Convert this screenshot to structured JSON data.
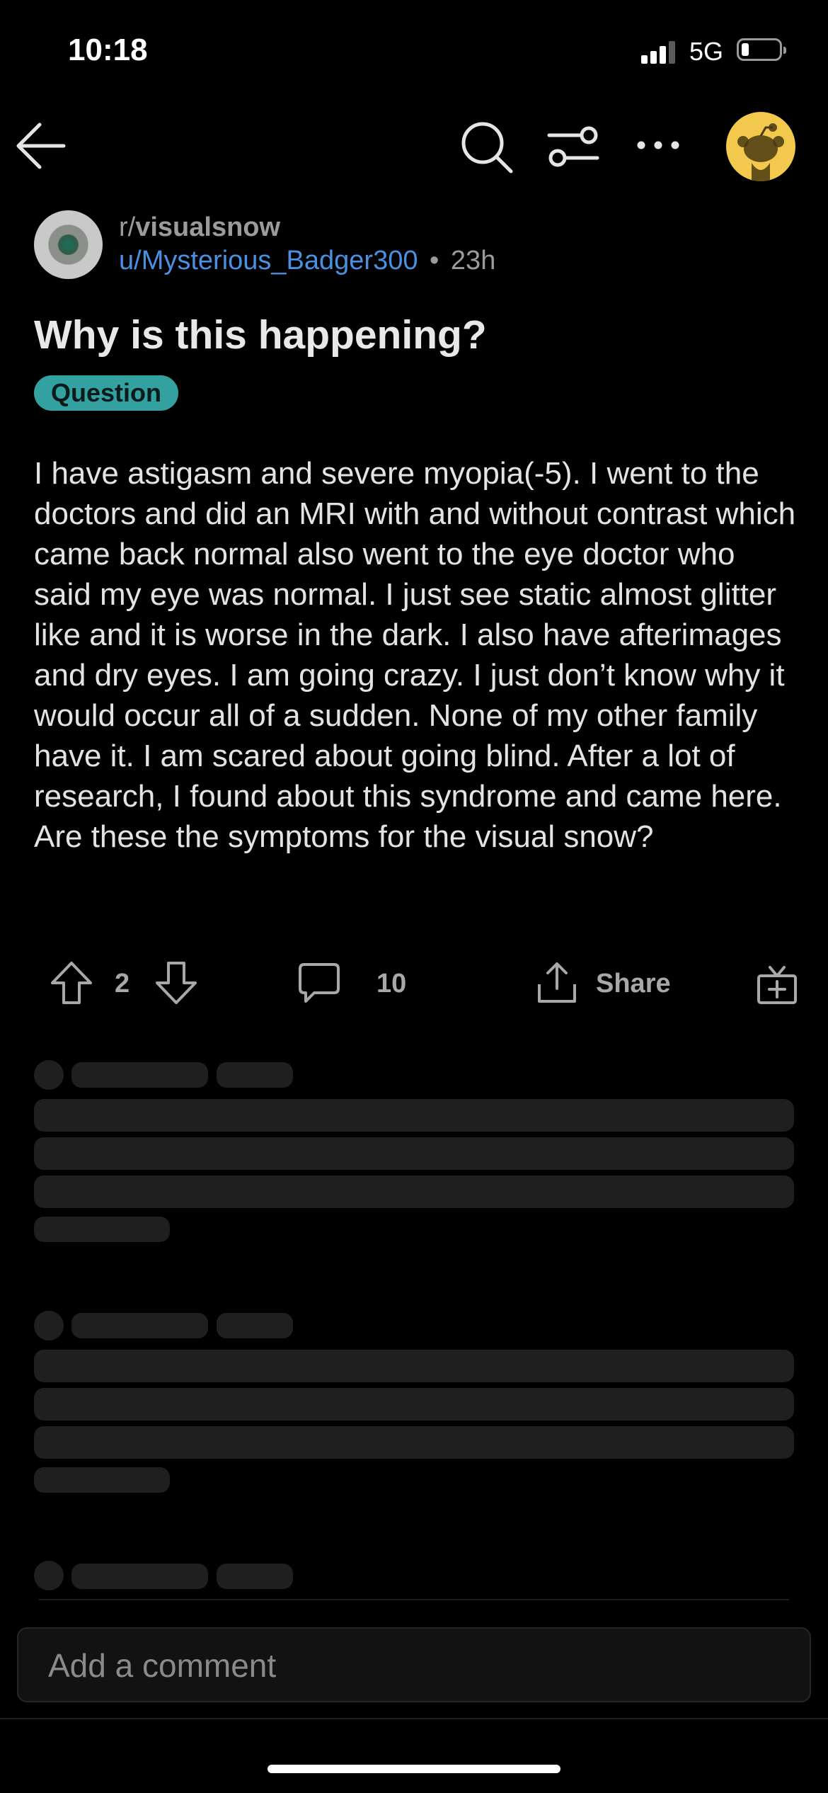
{
  "status_bar": {
    "time": "10:18",
    "network": "5G",
    "battery_level": 0.2
  },
  "nav": {
    "back_icon": "arrow-left-icon",
    "search_icon": "search-icon",
    "filter_icon": "sliders-icon",
    "more_icon": "more-horizontal-icon",
    "avatar_icon": "snoo-avatar-icon"
  },
  "post": {
    "subreddit_prefix": "r/",
    "subreddit": "visualsnow",
    "username": "u/Mysterious_Badger300",
    "separator": "•",
    "age": "23h",
    "title": "Why is this happening?",
    "flair": "Question",
    "body": "I have astigasm and severe myopia(-5). I went to the doctors and did an MRI with and without contrast which came back normal also went to the eye doctor who said my eye was normal. I just see static almost glitter like and it is worse in the dark. I also have afterimages and dry eyes. I am going crazy. I just don’t know why it would occur all of a sudden. None of my other family have it. I am scared about going blind. After a lot of research, I found about this syndrome and came here. Are these the symptoms for the visual snow?"
  },
  "actions": {
    "vote_count": "2",
    "comment_count": "10",
    "share_label": "Share",
    "award_icon": "gift-icon"
  },
  "composer": {
    "placeholder": "Add a comment"
  }
}
